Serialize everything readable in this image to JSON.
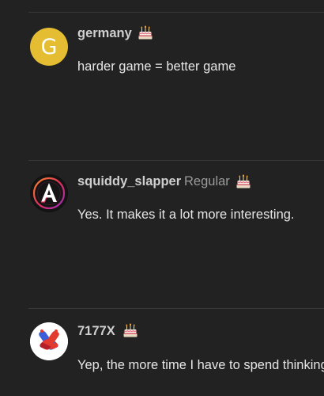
{
  "posts": [
    {
      "username": "germany",
      "avatar_letter": "G",
      "avatar_color": "#e4bd32",
      "badge_icon": "birthday-cake-icon",
      "body": "harder game = better game"
    },
    {
      "username": "squiddy_slapper",
      "user_title": "Regular",
      "avatar_icon": "letter-a-logo-avatar",
      "badge_icon": "birthday-cake-icon",
      "body": "Yes. It makes it a lot more interesting."
    },
    {
      "username": "7177X",
      "avatar_icon": "crossed-feet-avatar",
      "badge_icon": "birthday-cake-icon",
      "body": "Yep, the more time I have to spend thinking"
    }
  ],
  "colors": {
    "background": "#222222",
    "divider": "#383838",
    "username": "#cfcfcf",
    "user_title": "#9a9a9a",
    "body_text": "#e6e6e6"
  }
}
